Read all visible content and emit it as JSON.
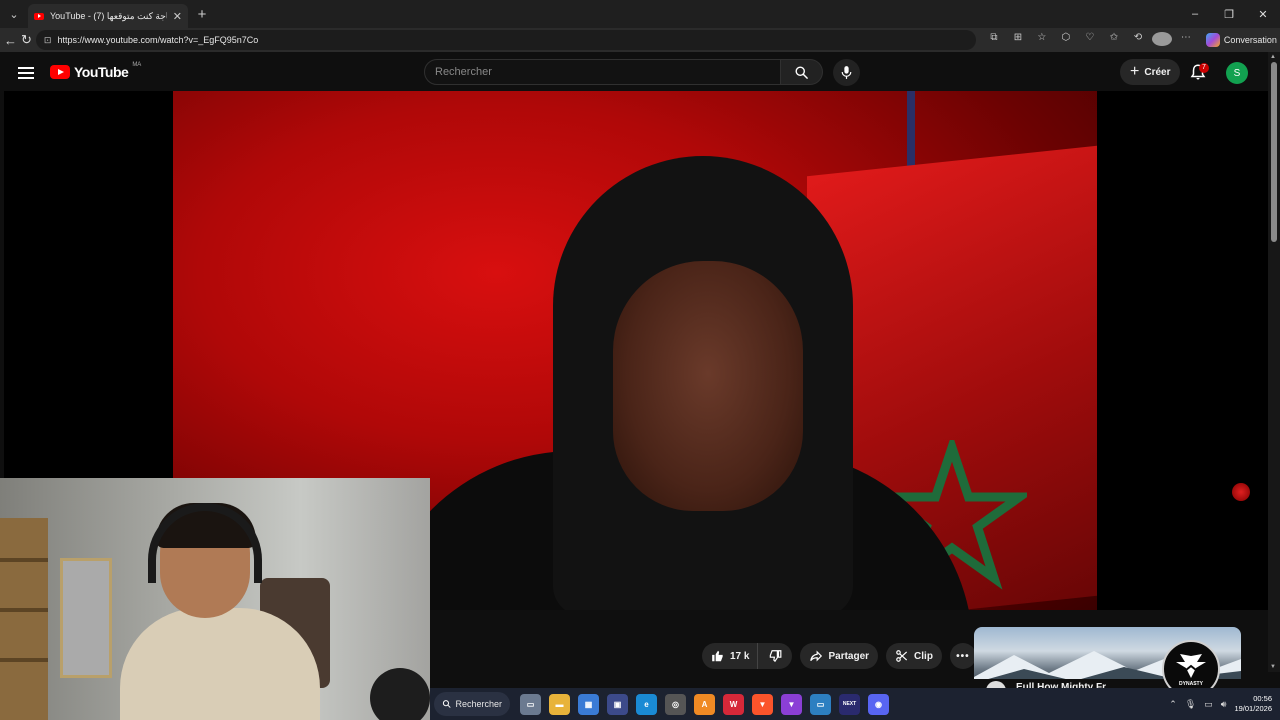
{
  "browser": {
    "tab_title": "YouTube - (7) أخر حاجة كنت متوقعها",
    "new_tab_symbol": "+",
    "url": "https://www.youtube.com/watch?v=_EgFQ95n7Co",
    "conversation_label": "Conversation",
    "window_controls": [
      "–",
      "❐",
      "✕"
    ]
  },
  "youtube": {
    "logo_text": "YouTube",
    "country_code": "MA",
    "search_placeholder": "Rechercher",
    "create_label": "Créer",
    "notification_count": "7",
    "avatar_letter": "S",
    "brand_red": "#ff0000"
  },
  "actions": {
    "likes": "17 k",
    "share_label": "Partager",
    "clip_label": "Clip",
    "more_label": "•••"
  },
  "recommendation": {
    "title": "Eull How Mighty Fr..."
  },
  "stream_logo": {
    "text": "DYNASTY"
  },
  "taskbar": {
    "search_label": "Rechercher",
    "apps": [
      {
        "name": "task-view-icon",
        "color": "#6b7a90",
        "glyph": "▭"
      },
      {
        "name": "file-explorer-icon",
        "color": "#e8b33a",
        "glyph": "▬"
      },
      {
        "name": "store-icon",
        "color": "#3a7bd5",
        "glyph": "▦"
      },
      {
        "name": "widget-app-icon",
        "color": "#3c4a8a",
        "glyph": "▣"
      },
      {
        "name": "edge-icon",
        "color": "#1a8ad4",
        "glyph": "e"
      },
      {
        "name": "chrome-icon",
        "color": "#555",
        "glyph": "◎"
      },
      {
        "name": "app-a-icon",
        "color": "#f08a24",
        "glyph": "A"
      },
      {
        "name": "app-w-icon",
        "color": "#d62839",
        "glyph": "W"
      },
      {
        "name": "brave-icon",
        "color": "#fb542b",
        "glyph": "▼"
      },
      {
        "name": "brave-nightly-icon",
        "color": "#8b3fd6",
        "glyph": "▼"
      },
      {
        "name": "windows-app-icon",
        "color": "#2d7fc1",
        "glyph": "▭"
      },
      {
        "name": "next-app-icon",
        "color": "#2a2a6e",
        "glyph": "NEXT"
      },
      {
        "name": "discord-icon",
        "color": "#5865f2",
        "glyph": "◉"
      }
    ],
    "time": "00:56",
    "date": "19/01/2026"
  }
}
